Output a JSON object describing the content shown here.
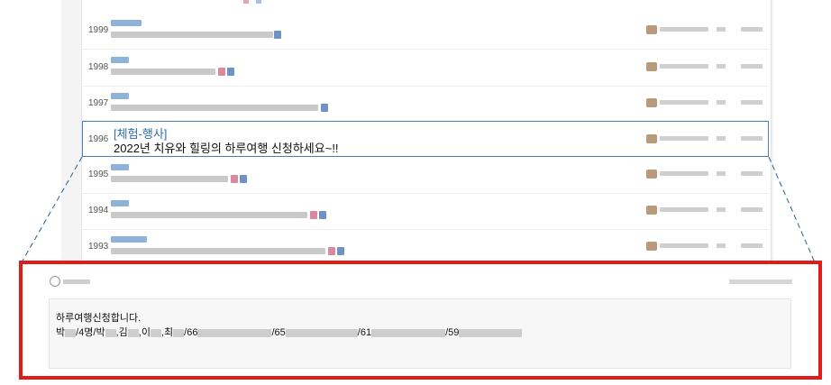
{
  "rows": [
    {
      "num": "1999"
    },
    {
      "num": "1998"
    },
    {
      "num": "1997"
    },
    {
      "num": "1996",
      "category": "[체험-행사]",
      "title": "2022년 치유와 힐링의 하루여행 신청하세요~!!"
    },
    {
      "num": "1995"
    },
    {
      "num": "1994"
    },
    {
      "num": "1993"
    }
  ],
  "comment": {
    "line1": "하루여행신청합니다.",
    "p_bak1": "박",
    "p_4": "/4명/박",
    "p_kim": ",김",
    "p_lee": ",이",
    "p_choi": ",최",
    "p_66": "/66",
    "p_65": "/65",
    "p_61": "/61",
    "p_59": "/59"
  },
  "colors": {
    "highlight_frame": "#e11a1a",
    "active_row_border": "#4a7fb5",
    "category_text": "#2e6db4"
  }
}
